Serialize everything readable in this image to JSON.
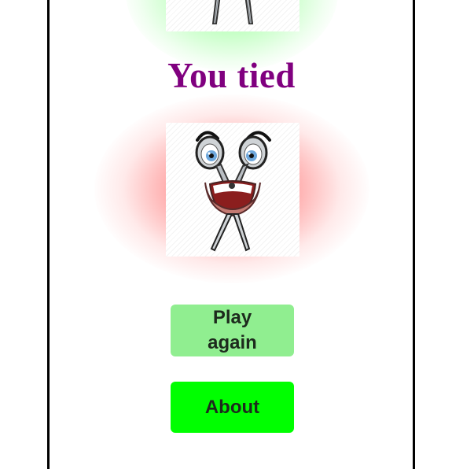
{
  "result": {
    "text": "You tied"
  },
  "buttons": {
    "play_again": "Play again",
    "about": "About"
  },
  "colors": {
    "result_text": "#80007f",
    "play_again_bg": "#90ee90",
    "about_bg": "#00ff00",
    "player_glow": "#3cff3c",
    "opponent_glow": "#ff2828"
  },
  "icons": {
    "player_choice": "scissors-icon",
    "opponent_choice": "scissors-icon"
  }
}
